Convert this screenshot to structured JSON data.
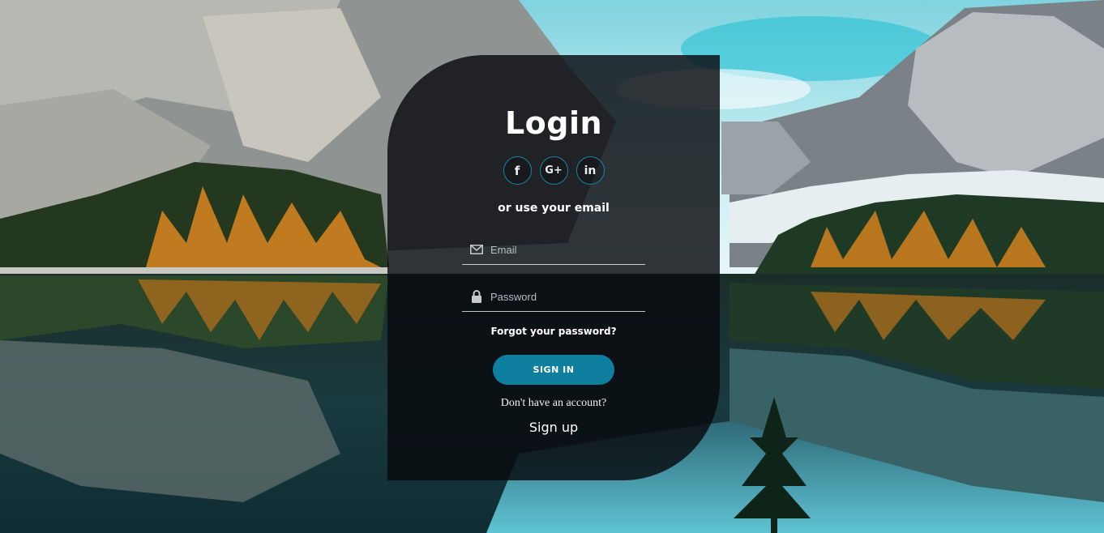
{
  "login": {
    "title": "Login",
    "socials": [
      {
        "label": "f",
        "icon": "facebook-icon"
      },
      {
        "label": "G+",
        "icon": "google-plus-icon"
      },
      {
        "label": "in",
        "icon": "linkedin-icon"
      }
    ],
    "subtitle": "or use your email",
    "email_placeholder": "Email",
    "password_placeholder": "Password",
    "forgot_label": "Forgot your password?",
    "signin_label": "SIGN IN",
    "no_account_text": "Don't have an account?",
    "signup_label": "Sign up"
  },
  "colors": {
    "accent": "#0e7f9f",
    "social_border": "#1487a8",
    "card_background": "#080a0e"
  }
}
